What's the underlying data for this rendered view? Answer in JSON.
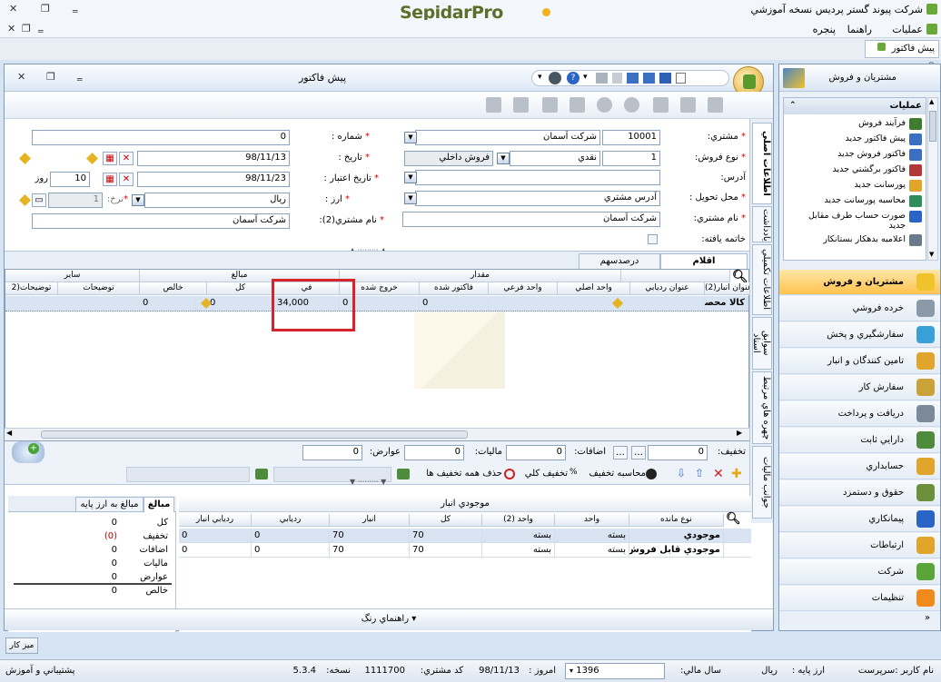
{
  "app": {
    "title": "شرکت پیوند گستر پردیس نسخه آموزشي",
    "logo": "SepidarPro"
  },
  "menu": {
    "operations": "عمليات",
    "help": "راهنما",
    "window": "پنجره"
  },
  "open_tab": {
    "label": "پیش فاکتور"
  },
  "doc": {
    "title": "پیش فاکتور"
  },
  "form": {
    "customer_label": "مشتري:",
    "customer_code": "10001",
    "customer_name": "شرکت آسمان",
    "sale_type_label": "نوع فروش:",
    "sale_type_code": "1",
    "sale_type_name": "نقدي",
    "sale_kind": "فروش داخلي",
    "address_label": "آدرس:",
    "delivery_label": "محل تحويل :",
    "delivery_value": "آدرس مشتري",
    "customer_name_label": "نام مشتري:",
    "customer_name_value": "شرکت آسمان",
    "closed_label": "خاتمه يافته:",
    "number_label": "شماره :",
    "number_value": "0",
    "date_label": "تاريخ :",
    "date_value": "98/11/13",
    "valid_label": "تاريخ اعتبار :",
    "valid_value": "98/11/23",
    "valid_days": "10",
    "days_unit": "روز",
    "currency_label": "ارز :",
    "currency_value": "ريال",
    "rate_label": "نرخ:",
    "rate_value": "1",
    "customer2_label": "نام مشتري(2):",
    "customer2_value": "شرکت آسمان"
  },
  "vtabs": [
    "اطلاعات اصلي",
    "يادداشت",
    "اطلاعات تکميلي",
    "سوابق اسناد",
    "چهره هاي مرتبط",
    "جوانب ماليات"
  ],
  "item_tabs": {
    "items": "اقلام",
    "percent": "درصدسهم"
  },
  "grid": {
    "group_headers": {
      "qty": "مقدار",
      "amounts": "مبالغ",
      "other": "ساير"
    },
    "columns": [
      "عنوان انبار(2)",
      "عنوان رديابي",
      "واحد اصلي",
      "واحد فرعي",
      "فاکتور شده",
      "خروج شده",
      "في",
      "کل",
      "خالص",
      "توضيحات",
      "توضيحات(2"
    ],
    "row": {
      "product": "کالا محصول",
      "fi": "34,000",
      "total": "0",
      "net": "0",
      "invoiced": "0",
      "exited": "0"
    }
  },
  "totals": {
    "discount_label": "تخفيف:",
    "discount": "0",
    "additions_label": "اضافات:",
    "additions": "0",
    "tax_label": "ماليات:",
    "tax": "0",
    "duties_label": "عوارض:",
    "duties": "0"
  },
  "actions": {
    "calc_discount": "محاسبه تخفيف",
    "total_discount": "تخفيف کلي",
    "remove_discounts": "حذف همه تخفيف ها"
  },
  "summary": {
    "tab_amounts": "مبالغ",
    "tab_base": "مبالغ به ارز پايه",
    "rows": [
      {
        "label": "کل",
        "value": "0"
      },
      {
        "label": "تخفيف",
        "value": "(0)"
      },
      {
        "label": "اضافات",
        "value": "0"
      },
      {
        "label": "ماليات",
        "value": "0"
      },
      {
        "label": "عوارض",
        "value": "0"
      },
      {
        "label": "خالص",
        "value": "0"
      }
    ]
  },
  "stock": {
    "title": "موجودي انبار",
    "columns": [
      "نوع مانده",
      "واحد",
      "واحد (2)",
      "کل",
      "انبار",
      "رديابي",
      "رديابي انبار"
    ],
    "rows": [
      {
        "type": "موجودي",
        "unit": "بسته",
        "unit2": "بسته",
        "total": "70",
        "store": "70",
        "track": "0",
        "track_store": "0"
      },
      {
        "type": "موجودي قابل فروش",
        "unit": "بسته",
        "unit2": "بسته",
        "total": "70",
        "store": "70",
        "track": "0",
        "track_store": "0"
      }
    ]
  },
  "color_guide": "راهنماي رنگ",
  "sidebar": {
    "header": "مشتريان و فروش",
    "ops_title": "عمليات",
    "links": [
      "فرآيند فروش",
      "پيش فاکتور جديد",
      "فاکتور فروش جديد",
      "فاکتور برگشتي جديد",
      "پورسانت جديد",
      "محاسبه پورسانت جديد",
      "صورت حساب طرف مقابل جديد",
      "اعلاميه بدهکار بستانکار"
    ],
    "modules": [
      "مشتريان و فروش",
      "خرده فروشي",
      "سفارشگيري و پخش",
      "تامين کنندگان و انبار",
      "سفارش کار",
      "دريافت و پرداخت",
      "دارايي ثابت",
      "حسابداري",
      "حقوق و دستمزد",
      "پيمانکاري",
      "ارتباطات",
      "شرکت",
      "تنظيمات"
    ]
  },
  "taskbar": {
    "desktop": "ميز کار"
  },
  "status": {
    "user": "نام کاربر :سرپرست",
    "base_currency": "ارز پايه :",
    "base_currency_value": "ريال",
    "fiscal_year": "سال مالي:",
    "year": "1396",
    "today": "امروز :",
    "today_value": "98/11/13",
    "customer_code": "کد مشتري:",
    "customer_code_value": "1111700",
    "version": "نسخه:",
    "version_value": "5.3.4",
    "support": "پشتيباني و آموزش"
  }
}
